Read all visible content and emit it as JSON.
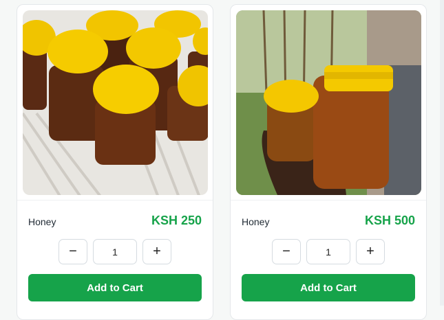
{
  "theme": {
    "accent": "#16a34a",
    "price_color": "#16a34a"
  },
  "products": [
    {
      "name": "Honey",
      "price": "KSH 250",
      "quantity": "1",
      "minus_label": "−",
      "plus_label": "+",
      "cart_label": "Add to Cart",
      "image": "honey-jars-crate-photo"
    },
    {
      "name": "Honey",
      "price": "KSH 500",
      "quantity": "1",
      "minus_label": "−",
      "plus_label": "+",
      "cart_label": "Add to Cart",
      "image": "honey-jars-in-hand-photo"
    }
  ]
}
